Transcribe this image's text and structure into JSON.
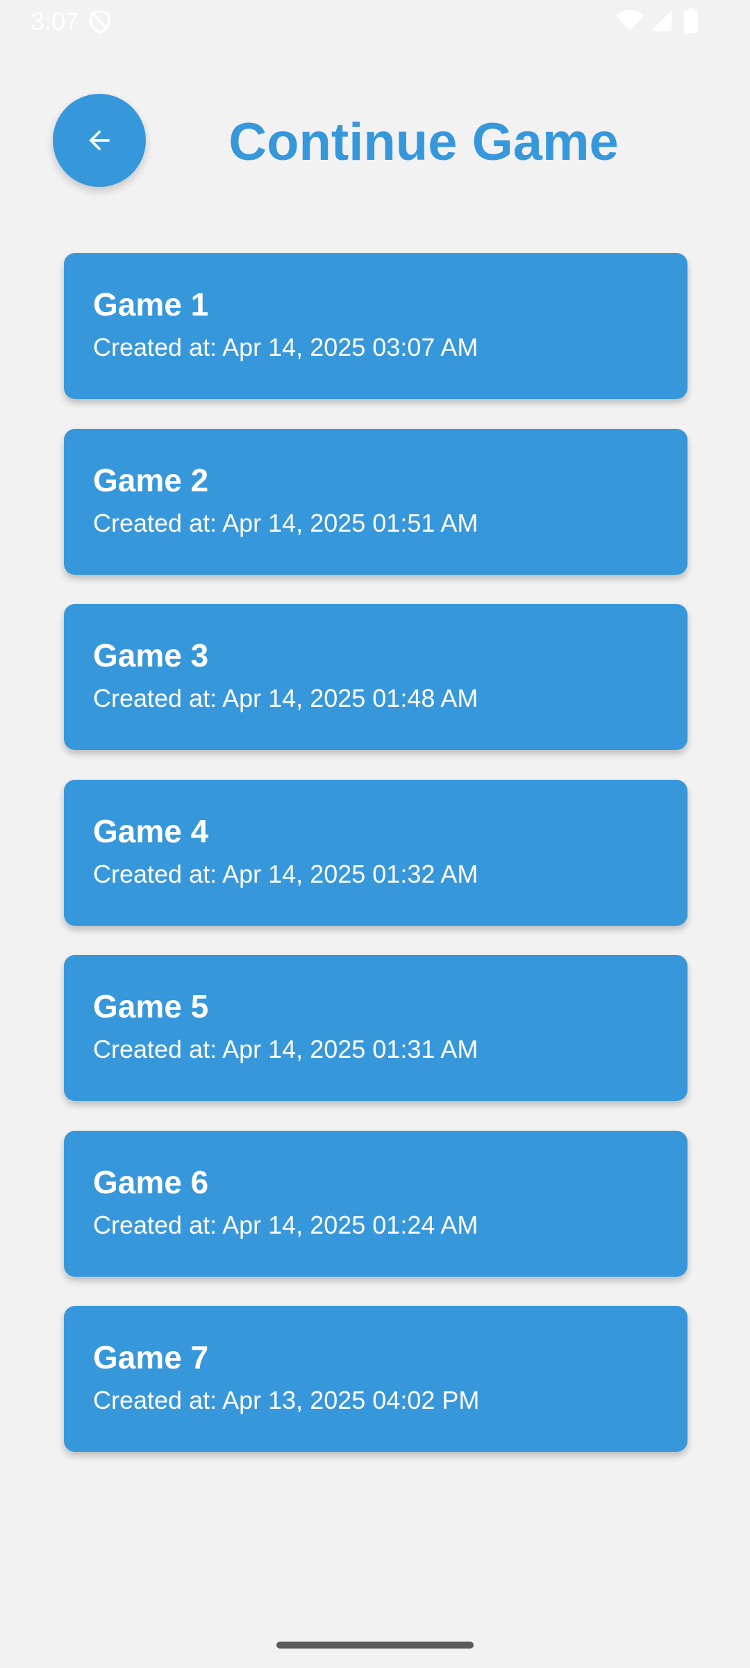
{
  "status_bar": {
    "time": "3:07",
    "icons": [
      "shield-icon",
      "wifi-icon",
      "signal-icon",
      "battery-icon"
    ]
  },
  "header": {
    "back_icon": "arrow-left-icon",
    "title": "Continue Game"
  },
  "games": [
    {
      "name": "Game 1",
      "created": "Created at: Apr 14, 2025 03:07 AM"
    },
    {
      "name": "Game 2",
      "created": "Created at: Apr 14, 2025 01:51 AM"
    },
    {
      "name": "Game 3",
      "created": "Created at: Apr 14, 2025 01:48 AM"
    },
    {
      "name": "Game 4",
      "created": "Created at: Apr 14, 2025 01:32 AM"
    },
    {
      "name": "Game 5",
      "created": "Created at: Apr 14, 2025 01:31 AM"
    },
    {
      "name": "Game 6",
      "created": "Created at: Apr 14, 2025 01:24 AM"
    },
    {
      "name": "Game 7",
      "created": "Created at: Apr 13, 2025 04:02 PM"
    }
  ],
  "colors": {
    "accent": "#3797db",
    "background": "#f2f2f2",
    "card_text": "#ffffff"
  }
}
